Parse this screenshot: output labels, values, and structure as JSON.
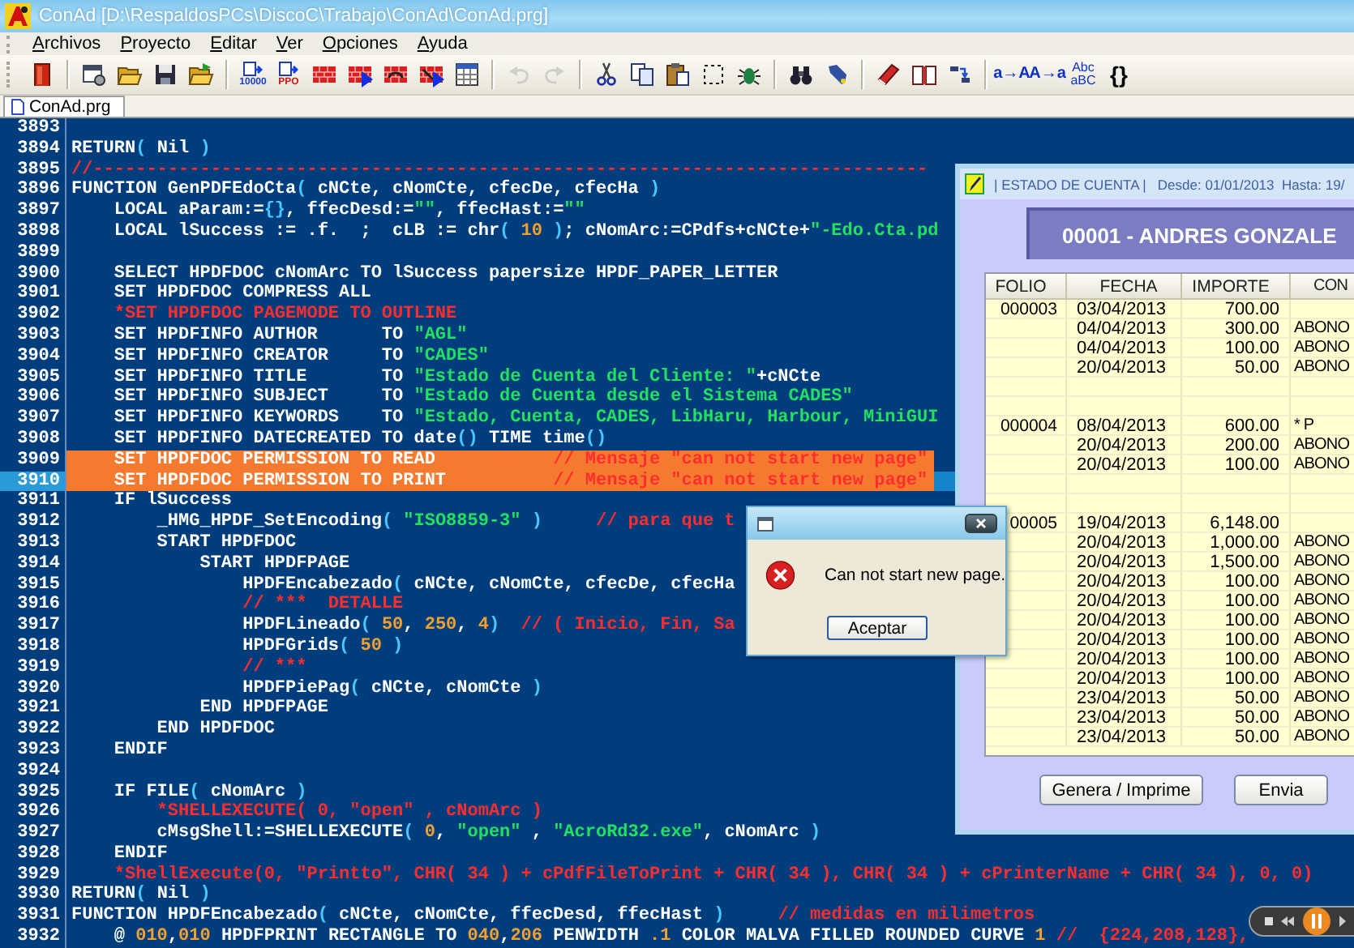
{
  "window": {
    "title": "ConAd [D:\\RespaldosPCs\\DiscoC\\Trabajo\\ConAd\\ConAd.prg]"
  },
  "menu": [
    "Archivos",
    "Proyecto",
    "Editar",
    "Ver",
    "Opciones",
    "Ayuda"
  ],
  "toolbar": [
    {
      "kind": "exit",
      "disabled": false
    },
    {
      "kind": "separator"
    },
    {
      "kind": "properties",
      "disabled": false
    },
    {
      "kind": "open",
      "disabled": false
    },
    {
      "kind": "save",
      "disabled": false
    },
    {
      "kind": "reopen",
      "disabled": false
    },
    {
      "kind": "separator"
    },
    {
      "kind": "compile",
      "caption": "10000",
      "disabled": false
    },
    {
      "kind": "ppo",
      "caption": "PPO",
      "disabled": false
    },
    {
      "kind": "build",
      "disabled": false
    },
    {
      "kind": "build_run",
      "disabled": false
    },
    {
      "kind": "rebuild",
      "disabled": false
    },
    {
      "kind": "rebuild_run",
      "disabled": false
    },
    {
      "kind": "table",
      "disabled": false
    },
    {
      "kind": "separator"
    },
    {
      "kind": "undo",
      "disabled": true
    },
    {
      "kind": "redo",
      "disabled": true
    },
    {
      "kind": "separator"
    },
    {
      "kind": "cut",
      "disabled": false
    },
    {
      "kind": "copy",
      "disabled": false
    },
    {
      "kind": "paste",
      "disabled": false
    },
    {
      "kind": "select",
      "disabled": false
    },
    {
      "kind": "debug",
      "disabled": false
    },
    {
      "kind": "separator"
    },
    {
      "kind": "find",
      "disabled": false
    },
    {
      "kind": "flashlight",
      "disabled": false
    },
    {
      "kind": "separator"
    },
    {
      "kind": "book",
      "disabled": false
    },
    {
      "kind": "open_book",
      "disabled": false
    },
    {
      "kind": "jump",
      "disabled": false
    },
    {
      "kind": "separator"
    },
    {
      "kind": "lower_to_upper",
      "lines": [
        "a→A"
      ],
      "disabled": false
    },
    {
      "kind": "upper_to_lower",
      "lines": [
        "A→a"
      ],
      "disabled": false
    },
    {
      "kind": "toggle_case",
      "lines": [
        "Abc",
        "aBC"
      ],
      "disabled": false
    },
    {
      "kind": "braces",
      "lines": [
        "{}"
      ],
      "disabled": false
    }
  ],
  "tabs": [
    {
      "label": "ConAd.prg",
      "selected": true
    }
  ],
  "editor": {
    "lines": [
      {
        "number": "3893",
        "highlighted": false,
        "current": false
      },
      {
        "number": "3894",
        "highlighted": false,
        "current": false,
        "segments": [
          {
            "kind": "plain",
            "text": "RETURN"
          },
          {
            "kind": "paren",
            "text": "("
          },
          {
            "kind": "plain",
            "text": " Nil "
          },
          {
            "kind": "paren",
            "text": ")"
          }
        ]
      },
      {
        "number": "3895",
        "highlighted": false,
        "current": false,
        "segments": [
          {
            "kind": "comment",
            "text": "//------------------------------------------------------------------------------"
          }
        ]
      },
      {
        "number": "3896",
        "highlighted": false,
        "current": false,
        "segments": [
          {
            "kind": "plain",
            "text": "FUNCTION GenPDFEdoCta"
          },
          {
            "kind": "paren",
            "text": "("
          },
          {
            "kind": "plain",
            "text": " cNCte, cNomCte, cfecDe, cfecHa "
          },
          {
            "kind": "paren",
            "text": ")"
          }
        ]
      },
      {
        "number": "3897",
        "highlighted": false,
        "current": false,
        "segments": [
          {
            "kind": "plain",
            "text": "    LOCAL aParam:="
          },
          {
            "kind": "paren",
            "text": "{}"
          },
          {
            "kind": "plain",
            "text": ", ffecDesd:="
          },
          {
            "kind": "string",
            "text": "\"\""
          },
          {
            "kind": "plain",
            "text": ", ffecHast:="
          },
          {
            "kind": "string",
            "text": "\"\""
          }
        ]
      },
      {
        "number": "3898",
        "highlighted": false,
        "current": false,
        "segments": [
          {
            "kind": "plain",
            "text": "    LOCAL lSuccess := .f.  ;  cLB := chr"
          },
          {
            "kind": "paren",
            "text": "( "
          },
          {
            "kind": "number",
            "text": "10"
          },
          {
            "kind": "paren",
            "text": " )"
          },
          {
            "kind": "plain",
            "text": "; cNomArc:=CPdfs+cNCte+"
          },
          {
            "kind": "string",
            "text": "\"-Edo.Cta.pd"
          }
        ]
      },
      {
        "number": "3899",
        "highlighted": false,
        "current": false
      },
      {
        "number": "3900",
        "highlighted": false,
        "current": false,
        "segments": [
          {
            "kind": "plain",
            "text": "    SELECT HPDFDOC cNomArc TO lSuccess papersize HPDF_PAPER_LETTER"
          }
        ]
      },
      {
        "number": "3901",
        "highlighted": false,
        "current": false,
        "segments": [
          {
            "kind": "plain",
            "text": "    SET HPDFDOC COMPRESS ALL"
          }
        ]
      },
      {
        "number": "3902",
        "highlighted": false,
        "current": false,
        "segments": [
          {
            "kind": "comment",
            "text": "    *SET HPDFDOC PAGEMODE TO OUTLINE"
          }
        ]
      },
      {
        "number": "3903",
        "highlighted": false,
        "current": false,
        "segments": [
          {
            "kind": "plain",
            "text": "    SET HPDFINFO AUTHOR      TO "
          },
          {
            "kind": "string",
            "text": "\"AGL\""
          }
        ]
      },
      {
        "number": "3904",
        "highlighted": false,
        "current": false,
        "segments": [
          {
            "kind": "plain",
            "text": "    SET HPDFINFO CREATOR     TO "
          },
          {
            "kind": "string",
            "text": "\"CADES\""
          }
        ]
      },
      {
        "number": "3905",
        "highlighted": false,
        "current": false,
        "segments": [
          {
            "kind": "plain",
            "text": "    SET HPDFINFO TITLE       TO "
          },
          {
            "kind": "string",
            "text": "\"Estado de Cuenta del Cliente: \""
          },
          {
            "kind": "plain",
            "text": "+cNCte"
          }
        ]
      },
      {
        "number": "3906",
        "highlighted": false,
        "current": false,
        "segments": [
          {
            "kind": "plain",
            "text": "    SET HPDFINFO SUBJECT     TO "
          },
          {
            "kind": "string",
            "text": "\"Estado de Cuenta desde el Sistema CADES\""
          }
        ]
      },
      {
        "number": "3907",
        "highlighted": false,
        "current": false,
        "segments": [
          {
            "kind": "plain",
            "text": "    SET HPDFINFO KEYWORDS    TO "
          },
          {
            "kind": "string",
            "text": "\"Estado, Cuenta, CADES, LibHaru, Harbour, MiniGUI"
          }
        ]
      },
      {
        "number": "3908",
        "highlighted": false,
        "current": false,
        "segments": [
          {
            "kind": "plain",
            "text": "    SET HPDFINFO DATECREATED TO date"
          },
          {
            "kind": "paren",
            "text": "()"
          },
          {
            "kind": "plain",
            "text": " TIME time"
          },
          {
            "kind": "paren",
            "text": "()"
          }
        ]
      },
      {
        "number": "3909",
        "highlighted": true,
        "current": false,
        "segments": [
          {
            "kind": "plain",
            "text": "    SET HPDFDOC PERMISSION TO READ           "
          },
          {
            "kind": "comment",
            "text": "// Mensaje \"can not start new page\""
          }
        ]
      },
      {
        "number": "3910",
        "highlighted": true,
        "current": true,
        "segments": [
          {
            "kind": "plain",
            "text": "    SET HPDFDOC PERMISSION TO PRINT          "
          },
          {
            "kind": "comment",
            "text": "// Mensaje \"can not start new page\""
          }
        ]
      },
      {
        "number": "3911",
        "highlighted": false,
        "current": false,
        "segments": [
          {
            "kind": "plain",
            "text": "    IF lSuccess"
          }
        ]
      },
      {
        "number": "3912",
        "highlighted": false,
        "current": false,
        "segments": [
          {
            "kind": "plain",
            "text": "        _HMG_HPDF_SetEncoding"
          },
          {
            "kind": "paren",
            "text": "( "
          },
          {
            "kind": "string",
            "text": "\"ISO8859-3\""
          },
          {
            "kind": "paren",
            "text": " )"
          },
          {
            "kind": "comment",
            "text": "     // para que t"
          }
        ]
      },
      {
        "number": "3913",
        "highlighted": false,
        "current": false,
        "segments": [
          {
            "kind": "plain",
            "text": "        START HPDFDOC"
          }
        ]
      },
      {
        "number": "3914",
        "highlighted": false,
        "current": false,
        "segments": [
          {
            "kind": "plain",
            "text": "            START HPDFPAGE"
          }
        ]
      },
      {
        "number": "3915",
        "highlighted": false,
        "current": false,
        "segments": [
          {
            "kind": "plain",
            "text": "                HPDFEncabezado"
          },
          {
            "kind": "paren",
            "text": "("
          },
          {
            "kind": "plain",
            "text": " cNCte, cNomCte, cfecDe, cfecHa"
          }
        ]
      },
      {
        "number": "3916",
        "highlighted": false,
        "current": false,
        "segments": [
          {
            "kind": "comment",
            "text": "                // ***  DETALLE"
          }
        ]
      },
      {
        "number": "3917",
        "highlighted": false,
        "current": false,
        "segments": [
          {
            "kind": "plain",
            "text": "                HPDFLineado"
          },
          {
            "kind": "paren",
            "text": "( "
          },
          {
            "kind": "number",
            "text": "50"
          },
          {
            "kind": "plain",
            "text": ", "
          },
          {
            "kind": "number",
            "text": "250"
          },
          {
            "kind": "plain",
            "text": ", "
          },
          {
            "kind": "number",
            "text": "4"
          },
          {
            "kind": "paren",
            "text": ")"
          },
          {
            "kind": "comment",
            "text": "  // ( Inicio, Fin, Sa"
          }
        ]
      },
      {
        "number": "3918",
        "highlighted": false,
        "current": false,
        "segments": [
          {
            "kind": "plain",
            "text": "                HPDFGrids"
          },
          {
            "kind": "paren",
            "text": "( "
          },
          {
            "kind": "number",
            "text": "50"
          },
          {
            "kind": "paren",
            "text": " )"
          }
        ]
      },
      {
        "number": "3919",
        "highlighted": false,
        "current": false,
        "segments": [
          {
            "kind": "comment",
            "text": "                // ***"
          }
        ]
      },
      {
        "number": "3920",
        "highlighted": false,
        "current": false,
        "segments": [
          {
            "kind": "plain",
            "text": "                HPDFPiePag"
          },
          {
            "kind": "paren",
            "text": "("
          },
          {
            "kind": "plain",
            "text": " cNCte, cNomCte "
          },
          {
            "kind": "paren",
            "text": ")"
          }
        ]
      },
      {
        "number": "3921",
        "highlighted": false,
        "current": false,
        "segments": [
          {
            "kind": "plain",
            "text": "            END HPDFPAGE"
          }
        ]
      },
      {
        "number": "3922",
        "highlighted": false,
        "current": false,
        "segments": [
          {
            "kind": "plain",
            "text": "        END HPDFDOC"
          }
        ]
      },
      {
        "number": "3923",
        "highlighted": false,
        "current": false,
        "segments": [
          {
            "kind": "plain",
            "text": "    ENDIF"
          }
        ]
      },
      {
        "number": "3924",
        "highlighted": false,
        "current": false
      },
      {
        "number": "3925",
        "highlighted": false,
        "current": false,
        "segments": [
          {
            "kind": "plain",
            "text": "    IF FILE"
          },
          {
            "kind": "paren",
            "text": "("
          },
          {
            "kind": "plain",
            "text": " cNomArc "
          },
          {
            "kind": "paren",
            "text": ")"
          }
        ]
      },
      {
        "number": "3926",
        "highlighted": false,
        "current": false,
        "segments": [
          {
            "kind": "comment",
            "text": "        *SHELLEXECUTE( 0, \"open\" , cNomArc )"
          }
        ]
      },
      {
        "number": "3927",
        "highlighted": false,
        "current": false,
        "segments": [
          {
            "kind": "plain",
            "text": "        cMsgShell:=SHELLEXECUTE"
          },
          {
            "kind": "paren",
            "text": "( "
          },
          {
            "kind": "number",
            "text": "0"
          },
          {
            "kind": "plain",
            "text": ", "
          },
          {
            "kind": "string",
            "text": "\"open\""
          },
          {
            "kind": "plain",
            "text": " , "
          },
          {
            "kind": "string",
            "text": "\"AcroRd32.exe\""
          },
          {
            "kind": "plain",
            "text": ", cNomArc "
          },
          {
            "kind": "paren",
            "text": ")"
          }
        ]
      },
      {
        "number": "3928",
        "highlighted": false,
        "current": false,
        "segments": [
          {
            "kind": "plain",
            "text": "    ENDIF"
          }
        ]
      },
      {
        "number": "3929",
        "highlighted": false,
        "current": false,
        "segments": [
          {
            "kind": "comment",
            "text": "    *ShellExecute(0, \"Printto\", CHR( 34 ) + cPdfFileToPrint + CHR( 34 ), CHR( 34 ) + cPrinterName + CHR( 34 ), 0, 0)"
          }
        ]
      },
      {
        "number": "3930",
        "highlighted": false,
        "current": false,
        "segments": [
          {
            "kind": "plain",
            "text": "RETURN"
          },
          {
            "kind": "paren",
            "text": "("
          },
          {
            "kind": "plain",
            "text": " Nil "
          },
          {
            "kind": "paren",
            "text": ")"
          }
        ]
      },
      {
        "number": "3931",
        "highlighted": false,
        "current": false,
        "segments": [
          {
            "kind": "plain",
            "text": "FUNCTION HPDFEncabezado"
          },
          {
            "kind": "paren",
            "text": "("
          },
          {
            "kind": "plain",
            "text": " cNCte, cNomCte, ffecDesd, ffecHast "
          },
          {
            "kind": "paren",
            "text": ")"
          },
          {
            "kind": "comment",
            "text": "     // medidas en milimetros"
          }
        ]
      },
      {
        "number": "3932",
        "highlighted": false,
        "current": false,
        "segments": [
          {
            "kind": "plain",
            "text": "    @ "
          },
          {
            "kind": "number",
            "text": "010"
          },
          {
            "kind": "plain",
            "text": ","
          },
          {
            "kind": "number",
            "text": "010"
          },
          {
            "kind": "plain",
            "text": " HPDFPRINT RECTANGLE TO "
          },
          {
            "kind": "number",
            "text": "040"
          },
          {
            "kind": "plain",
            "text": ","
          },
          {
            "kind": "number",
            "text": "206"
          },
          {
            "kind": "plain",
            "text": " PENWIDTH "
          },
          {
            "kind": "number",
            "text": ".1"
          },
          {
            "kind": "plain",
            "text": " COLOR MALVA FILLED ROUNDED CURVE "
          },
          {
            "kind": "number",
            "text": "1"
          },
          {
            "kind": "comment",
            "text": " //  {224,208,128},"
          }
        ]
      }
    ]
  },
  "statement_window": {
    "title": "| ESTADO DE CUENTA |   Desde: 01/01/2013  Hasta: 19/",
    "customer": "00001 - ANDRES GONZALE",
    "table": {
      "columns": [
        "FOLIO",
        "FECHA",
        "IMPORTE",
        "CON"
      ],
      "rows": [
        {
          "folio": "000003",
          "fecha": "03/04/2013",
          "importe": "700.00"
        },
        {
          "fecha": "04/04/2013",
          "importe": "300.00",
          "column_4": "ABONO"
        },
        {
          "fecha": "04/04/2013",
          "importe": "100.00",
          "column_4": "ABONO"
        },
        {
          "fecha": "20/04/2013",
          "importe": "50.00",
          "column_4": "ABONO"
        },
        {},
        {},
        {
          "folio": "000004",
          "fecha": "08/04/2013",
          "importe": "600.00",
          "column_4": "* P"
        },
        {
          "fecha": "20/04/2013",
          "importe": "200.00",
          "column_4": "ABONO"
        },
        {
          "fecha": "20/04/2013",
          "importe": "100.00",
          "column_4": "ABONO"
        },
        {},
        {},
        {
          "folio": "00005",
          "fecha": "19/04/2013",
          "importe": "6,148.00"
        },
        {
          "fecha": "20/04/2013",
          "importe": "1,000.00",
          "column_4": "ABONO"
        },
        {
          "fecha": "20/04/2013",
          "importe": "1,500.00",
          "column_4": "ABONO"
        },
        {
          "fecha": "20/04/2013",
          "importe": "100.00",
          "column_4": "ABONO"
        },
        {
          "fecha": "20/04/2013",
          "importe": "100.00",
          "column_4": "ABONO"
        },
        {
          "fecha": "20/04/2013",
          "importe": "100.00",
          "column_4": "ABONO"
        },
        {
          "fecha": "20/04/2013",
          "importe": "100.00",
          "column_4": "ABONO"
        },
        {
          "fecha": "20/04/2013",
          "importe": "100.00",
          "column_4": "ABONO"
        },
        {
          "fecha": "20/04/2013",
          "importe": "100.00",
          "column_4": "ABONO"
        },
        {
          "fecha": "23/04/2013",
          "importe": "50.00",
          "column_4": "ABONO"
        },
        {
          "fecha": "23/04/2013",
          "importe": "50.00",
          "column_4": "ABONO"
        },
        {
          "fecha": "23/04/2013",
          "importe": "50.00",
          "column_4": "ABONO"
        }
      ]
    },
    "buttons": [
      "Genera / Imprime",
      "Envia"
    ]
  },
  "message_box": {
    "text": "Can not start new page.",
    "button": "Aceptar"
  }
}
